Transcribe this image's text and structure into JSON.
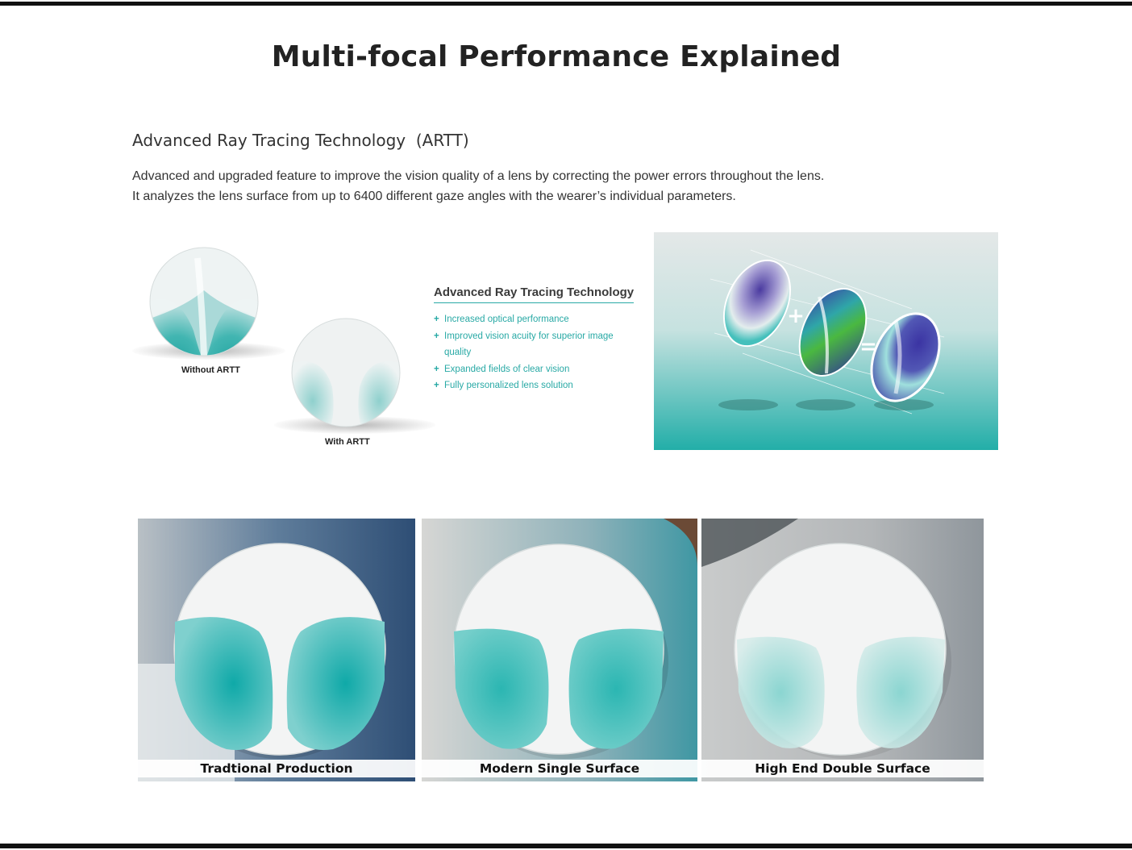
{
  "page": {
    "title": "Multi-focal Performance Explained"
  },
  "artt_section": {
    "heading": "Advanced Ray Tracing Technology  (ARTT)",
    "description_lines": [
      "Advanced and upgraded feature to improve the vision quality of a lens by correcting the power errors throughout the lens.",
      "It analyzes the lens surface from up to 6400 different gaze angles with the wearer’s individual parameters."
    ],
    "comparison": {
      "without_label": "Without ARTT",
      "with_label": "With ARTT"
    },
    "feature_box": {
      "title": "Advanced Ray Tracing Technology",
      "bullet_symbol": "+",
      "items": [
        "Increased optical performance",
        "Improved vision acuity for superior image",
        "quality",
        "Expanded fields of clear vision",
        "Fully personalized lens solution"
      ]
    },
    "illustration": {
      "plus_symbol": "+",
      "equals_symbol": "="
    }
  },
  "production_tiles": [
    {
      "caption": "Tradtional Production"
    },
    {
      "caption": "Modern Single Surface"
    },
    {
      "caption": "High End Double Surface"
    }
  ],
  "colors": {
    "teal": "#2aa9a6",
    "bar": "#111111"
  }
}
